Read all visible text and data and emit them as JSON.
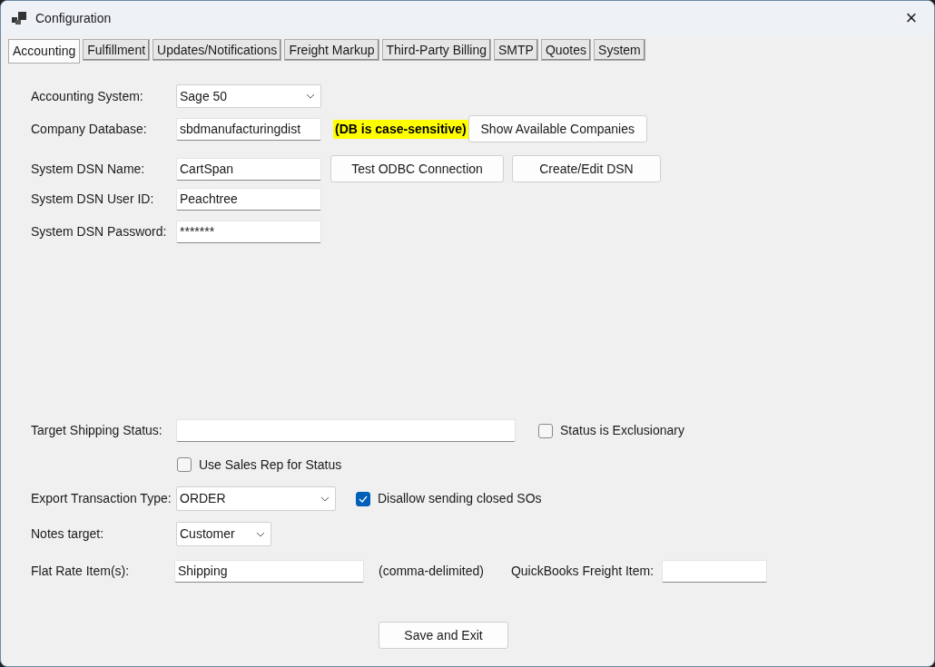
{
  "window": {
    "title": "Configuration",
    "close": "×"
  },
  "tabs": [
    {
      "label": "Accounting",
      "selected": true
    },
    {
      "label": "Fulfillment",
      "selected": false
    },
    {
      "label": "Updates/Notifications",
      "selected": false
    },
    {
      "label": "Freight Markup",
      "selected": false
    },
    {
      "label": "Third-Party Billing",
      "selected": false
    },
    {
      "label": "SMTP",
      "selected": false
    },
    {
      "label": "Quotes",
      "selected": false
    },
    {
      "label": "System",
      "selected": false
    }
  ],
  "accounting_system": {
    "label": "Accounting System:",
    "value": "Sage 50"
  },
  "company_database": {
    "label": "Company Database:",
    "value": "sbdmanufacturingdist",
    "note": "(DB is case-sensitive)",
    "button": "Show Available Companies"
  },
  "dsn_name": {
    "label": "System DSN Name:",
    "value": "CartSpan",
    "buttons": [
      "Test ODBC Connection",
      "Create/Edit DSN"
    ]
  },
  "dsn_user": {
    "label": "System DSN User ID:",
    "value": "Peachtree"
  },
  "dsn_password": {
    "label": "System DSN Password:",
    "value": "*******"
  },
  "target_shipping_status": {
    "label": "Target Shipping Status:",
    "checkbox": {
      "label": "Status is Exclusionary",
      "checked": false
    }
  },
  "use_sales_rep": {
    "label": "Use Sales Rep for Status",
    "checked": false
  },
  "export_transaction_type": {
    "label": "Export Transaction Type:",
    "value": "ORDER",
    "checkbox": {
      "label": "Disallow sending closed SOs",
      "checked": true
    }
  },
  "notes_target": {
    "label": "Notes target:",
    "value": "Customer"
  },
  "flat_rate_items": {
    "label": "Flat Rate Item(s):",
    "value": "Shipping",
    "hint": "(comma-delimited)",
    "freight_item_label": "QuickBooks Freight Item:"
  },
  "save_button": "Save and Exit"
}
